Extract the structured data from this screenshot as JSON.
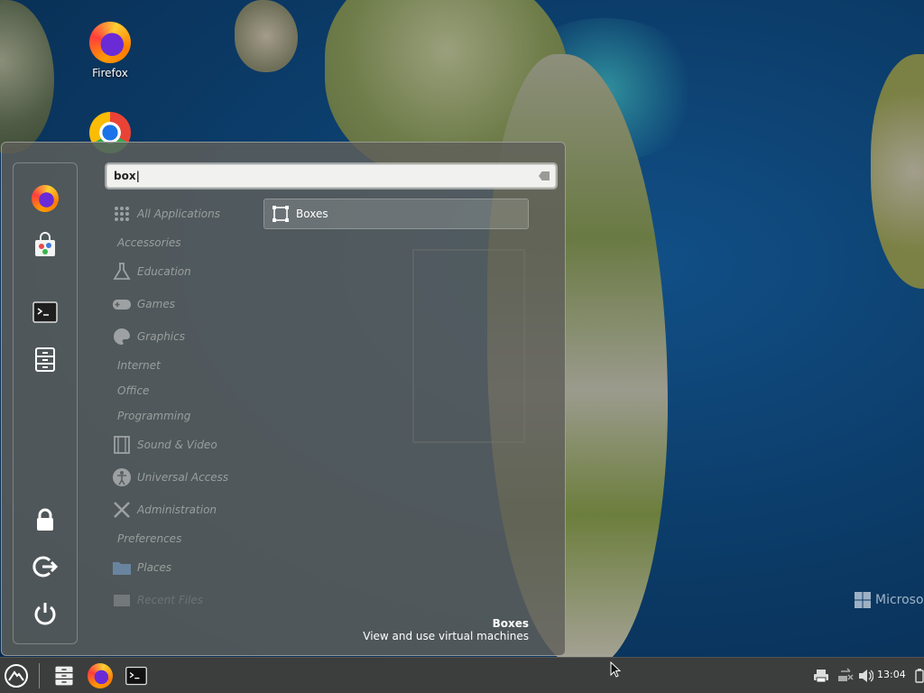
{
  "desktop": {
    "icons": [
      {
        "label": "Firefox"
      },
      {
        "label": ""
      }
    ],
    "watermark": "Microso"
  },
  "menu": {
    "search": {
      "value": "box|"
    },
    "favorites": [
      "firefox-icon",
      "software-store-icon",
      "terminal-icon",
      "file-manager-icon",
      "lock-icon",
      "logout-icon",
      "power-icon"
    ],
    "categories": [
      {
        "label": "All Applications"
      },
      {
        "label": "Accessories"
      },
      {
        "label": "Education"
      },
      {
        "label": "Games"
      },
      {
        "label": "Graphics"
      },
      {
        "label": "Internet"
      },
      {
        "label": "Office"
      },
      {
        "label": "Programming"
      },
      {
        "label": "Sound & Video"
      },
      {
        "label": "Universal Access"
      },
      {
        "label": "Administration"
      },
      {
        "label": "Preferences"
      },
      {
        "label": "Places"
      },
      {
        "label": "Recent Files"
      }
    ],
    "result": {
      "label": "Boxes"
    },
    "description": {
      "title": "Boxes",
      "text": "View and use virtual machines"
    }
  },
  "taskbar": {
    "clock": "13:04"
  }
}
